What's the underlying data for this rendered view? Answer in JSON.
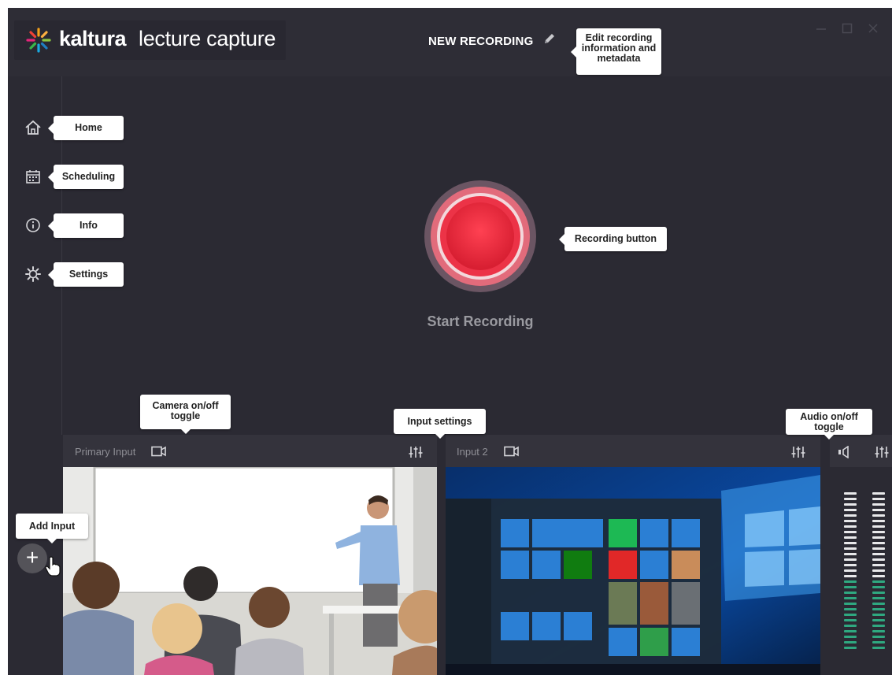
{
  "app": {
    "logo_brand": "kaltura",
    "logo_product": "lecture capture",
    "recording_title": "NEW RECORDING",
    "icons": {
      "pencil": "edit-pencil-icon",
      "minimize": "minimize-icon",
      "maximize": "maximize-icon",
      "close": "close-icon"
    }
  },
  "tooltips": {
    "edit_info": "Edit recording information and metadata",
    "recording_button": "Recording button",
    "camera_toggle": "Camera on/off toggle",
    "input_settings": "Input settings",
    "audio_toggle": "Audio on/off toggle",
    "add_input": "Add Input"
  },
  "sidebar": {
    "items": [
      {
        "label": "Home",
        "icon": "home-icon"
      },
      {
        "label": "Scheduling",
        "icon": "calendar-icon"
      },
      {
        "label": "Info",
        "icon": "info-icon"
      },
      {
        "label": "Settings",
        "icon": "gear-icon"
      }
    ]
  },
  "main": {
    "start_label": "Start Recording"
  },
  "inputs": {
    "primary_label": "Primary Input",
    "second_label": "Input 2"
  },
  "audio_meter": {
    "level": 0.45
  },
  "colors": {
    "accent_red": "#e8283c",
    "background": "#2b2a33",
    "meter_green": "#2fa880",
    "meter_white": "#e8e8ea"
  }
}
